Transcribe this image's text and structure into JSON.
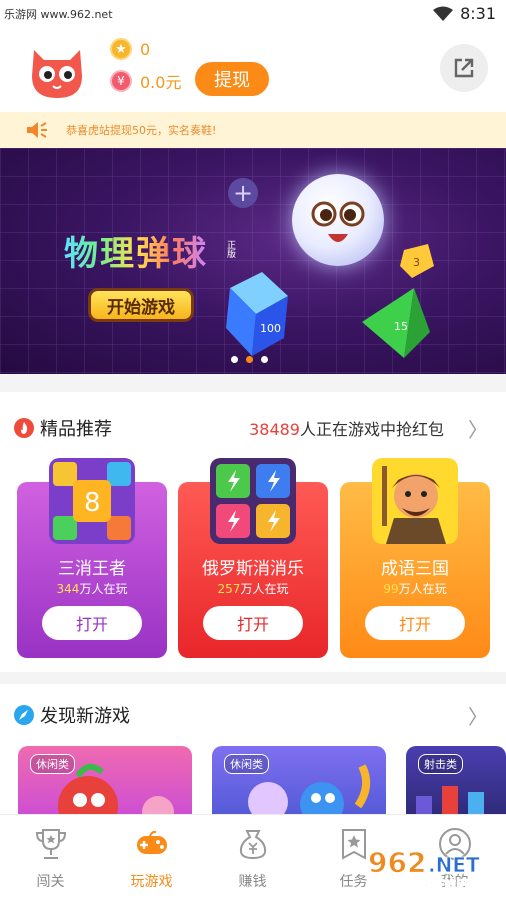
{
  "status_bar": {
    "watermark": "乐游网 www.962.net",
    "time": "8:31"
  },
  "header": {
    "coins": "0",
    "balance": "0.0元",
    "withdraw_label": "提现",
    "coin_icon": "star-coin-icon",
    "balance_icon": "yuan-icon"
  },
  "notice": {
    "text": "恭喜虎站提现50元，实名奏鞋!"
  },
  "banner": {
    "title": "物理弹球",
    "subtitle": "正版",
    "button_label": "开始游戏",
    "cube_text": "100",
    "gem_text": "3",
    "pyramid_text": "15",
    "active_dot": 1
  },
  "featured": {
    "title": "精品推荐",
    "count": "38489",
    "count_suffix": "人正在游戏中抢红包",
    "cards": [
      {
        "name": "三消王者",
        "players": "344",
        "players_suffix": "万人在玩",
        "open_label": "打开",
        "accent": "#9932c4",
        "icon_text": "8"
      },
      {
        "name": "俄罗斯消消乐",
        "players": "257",
        "players_suffix": "万人在玩",
        "open_label": "打开",
        "accent": "#e8262a"
      },
      {
        "name": "成语三国",
        "players": "99",
        "players_suffix": "万人在玩",
        "open_label": "打开",
        "accent": "#ff8a16"
      }
    ]
  },
  "discover": {
    "title": "发现新游戏",
    "items": [
      {
        "tag": "休闲类"
      },
      {
        "tag": "休闲类"
      },
      {
        "tag": "射击类"
      }
    ]
  },
  "tabs": [
    {
      "label": "闯关",
      "icon": "trophy-icon"
    },
    {
      "label": "玩游戏",
      "icon": "gamepad-icon"
    },
    {
      "label": "赚钱",
      "icon": "money-bag-icon"
    },
    {
      "label": "任务",
      "icon": "star-task-icon"
    },
    {
      "label": "我的",
      "icon": "user-icon"
    }
  ],
  "watermark_bottom": "962.NET 乐游网"
}
